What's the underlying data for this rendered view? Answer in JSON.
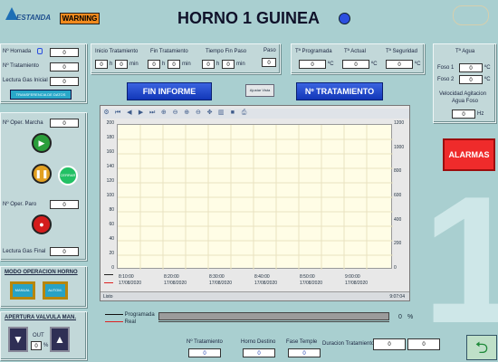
{
  "header": {
    "logo_text": "ESTANDA",
    "warning_label": "WARNING",
    "title": "HORNO 1 GUINEA"
  },
  "left": {
    "hornada_label": "Nº Hornada",
    "hornada_value": "0",
    "tratamiento_label": "Nº Tratamiento",
    "tratamiento_value": "0",
    "lectura_inicial_label": "Lectura Gas Inicial",
    "lectura_inicial_value": "0",
    "transfer_button": "TRANSFERENCIA DE DATOS",
    "oper_marcha_label": "Nº Oper. Marcha",
    "oper_marcha_value": "0",
    "small_button": "CERRAR",
    "oper_paro_label": "Nº Oper. Paro",
    "oper_paro_value": "0",
    "lectura_final_label": "Lectura Gas Final",
    "lectura_final_value": "0"
  },
  "modo": {
    "title": "MODO OPERACION HORNO",
    "btn1": "MANUAL",
    "btn2": "AUTOM."
  },
  "valvula": {
    "title": "APERTURA VALVULA MAN.",
    "out_label": "OUT",
    "value": "0",
    "unit": "%"
  },
  "times": {
    "inicio_label": "Inicio Tratamiento",
    "fin_label": "Fin Tratamiento",
    "tiempo_label": "Tiempo Fin Paso",
    "paso_label": "Paso",
    "h_unit": "h",
    "min_unit": "min",
    "inicio_h": "0",
    "inicio_min": "0",
    "fin_h": "0",
    "fin_min": "0",
    "tiempo_h": "0",
    "tiempo_min": "0",
    "paso_value": "0"
  },
  "temps": {
    "programada_label": "Tª Programada",
    "programada_value": "0",
    "actual_label": "Tª Actual",
    "actual_value": "0",
    "seguridad_label": "Tª Seguridad",
    "seguridad_value": "0",
    "unit": "ºC"
  },
  "agua": {
    "title": "Tª Agua",
    "fase1_label": "Foso 1",
    "fase1_value": "0",
    "fase2_label": "Foso 2",
    "fase2_value": "0",
    "vel_label1": "Velocidad Agitacion",
    "vel_label2": "Agua Foso",
    "vel_value": "0",
    "vel_unit": "Hz"
  },
  "buttons": {
    "fin_informe": "FIN INFORME",
    "ajustar": "Ajustar Vista",
    "n_tratamiento": "Nº TRATAMIENTO",
    "alarmas": "ALARMAS"
  },
  "big_number": "1",
  "chart": {
    "y_left": [
      "200",
      "180",
      "160",
      "140",
      "120",
      "100",
      "80",
      "60",
      "40",
      "20",
      "0"
    ],
    "y_right": [
      "1200",
      "1000",
      "800",
      "600",
      "400",
      "200",
      "0"
    ],
    "x_times": [
      "8:10:00",
      "8:20:00",
      "8:30:00",
      "8:40:00",
      "8:50:00",
      "9:00:00"
    ],
    "x_dates": [
      "17/08/2020",
      "17/08/2020",
      "17/08/2020",
      "17/08/2020",
      "17/08/2020",
      "17/08/2020"
    ],
    "status_left": "Listo",
    "status_right": "9:07:04"
  },
  "legend": {
    "programada": "Programada",
    "real": "Real",
    "percent_value": "0",
    "percent_unit": "%"
  },
  "bottom": {
    "tratamiento_label": "Nº Tratamiento",
    "tratamiento_value": "0",
    "horno_label": "Horno Destino",
    "horno_value": "0",
    "fase_label": "Fase Temple",
    "fase_value": "0",
    "duracion_label": "Duracion Tratamiento",
    "duracion_a": "0",
    "duracion_b": "0"
  }
}
